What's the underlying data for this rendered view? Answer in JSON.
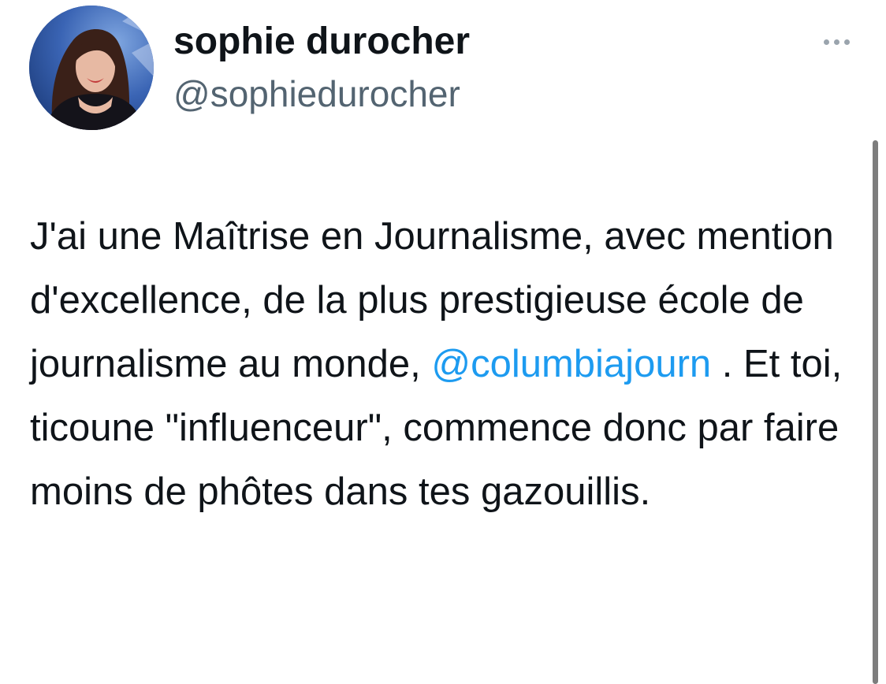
{
  "author": {
    "display_name": "sophie durocher",
    "handle": "@sophiedurocher",
    "avatar_icon": "profile-photo"
  },
  "more_icon": "more-horizontal-icon",
  "tweet": {
    "segments": {
      "part1": "J'ai une Maîtrise en Journalisme, avec mention d'excellence, de la plus prestigieuse école de journalisme au monde, ",
      "mention": "@columbiajourn",
      "part2": " . Et toi, ticoune \"influenceur\", commence donc par faire moins de phôtes dans tes gazouillis."
    }
  },
  "colors": {
    "text": "#0f1419",
    "secondary_text": "#536471",
    "mention": "#1d9bf0",
    "scrollbar": "#7d7d7d"
  }
}
